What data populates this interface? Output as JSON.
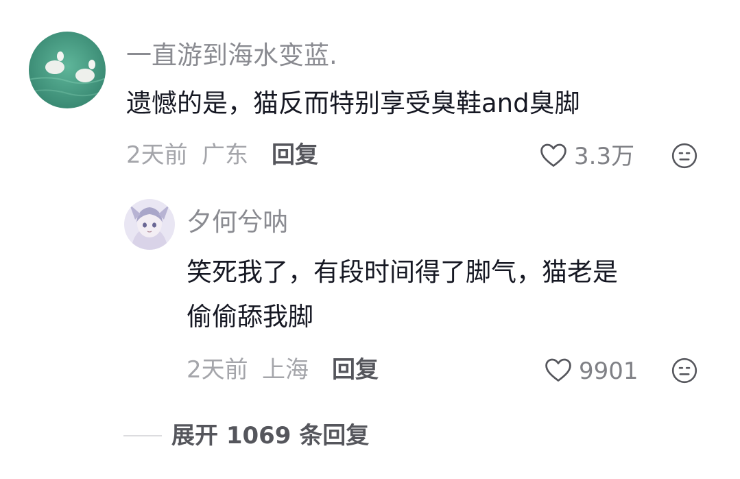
{
  "comment": {
    "username": "一直游到海水变蓝.",
    "content": "遗憾的是，猫反而特别享受臭鞋and臭脚",
    "time": "2天前",
    "location": "广东",
    "reply_label": "回复",
    "like_count": "3.3万"
  },
  "reply": {
    "username": "夕何兮呐",
    "content_line1": "笑死我了，有段时间得了脚气，猫老是",
    "content_line2": "偷偷舔我脚",
    "time": "2天前",
    "location": "上海",
    "reply_label": "回复",
    "like_count": "9901"
  },
  "expand_label": "展开 1069 条回复",
  "icons": {
    "like": "heart-outline-icon",
    "dislike": "meh-face-icon"
  },
  "colors": {
    "primary_text": "#161823",
    "username": "#8a8b91",
    "meta": "#a4a5aa",
    "reply_button": "#55565c"
  }
}
